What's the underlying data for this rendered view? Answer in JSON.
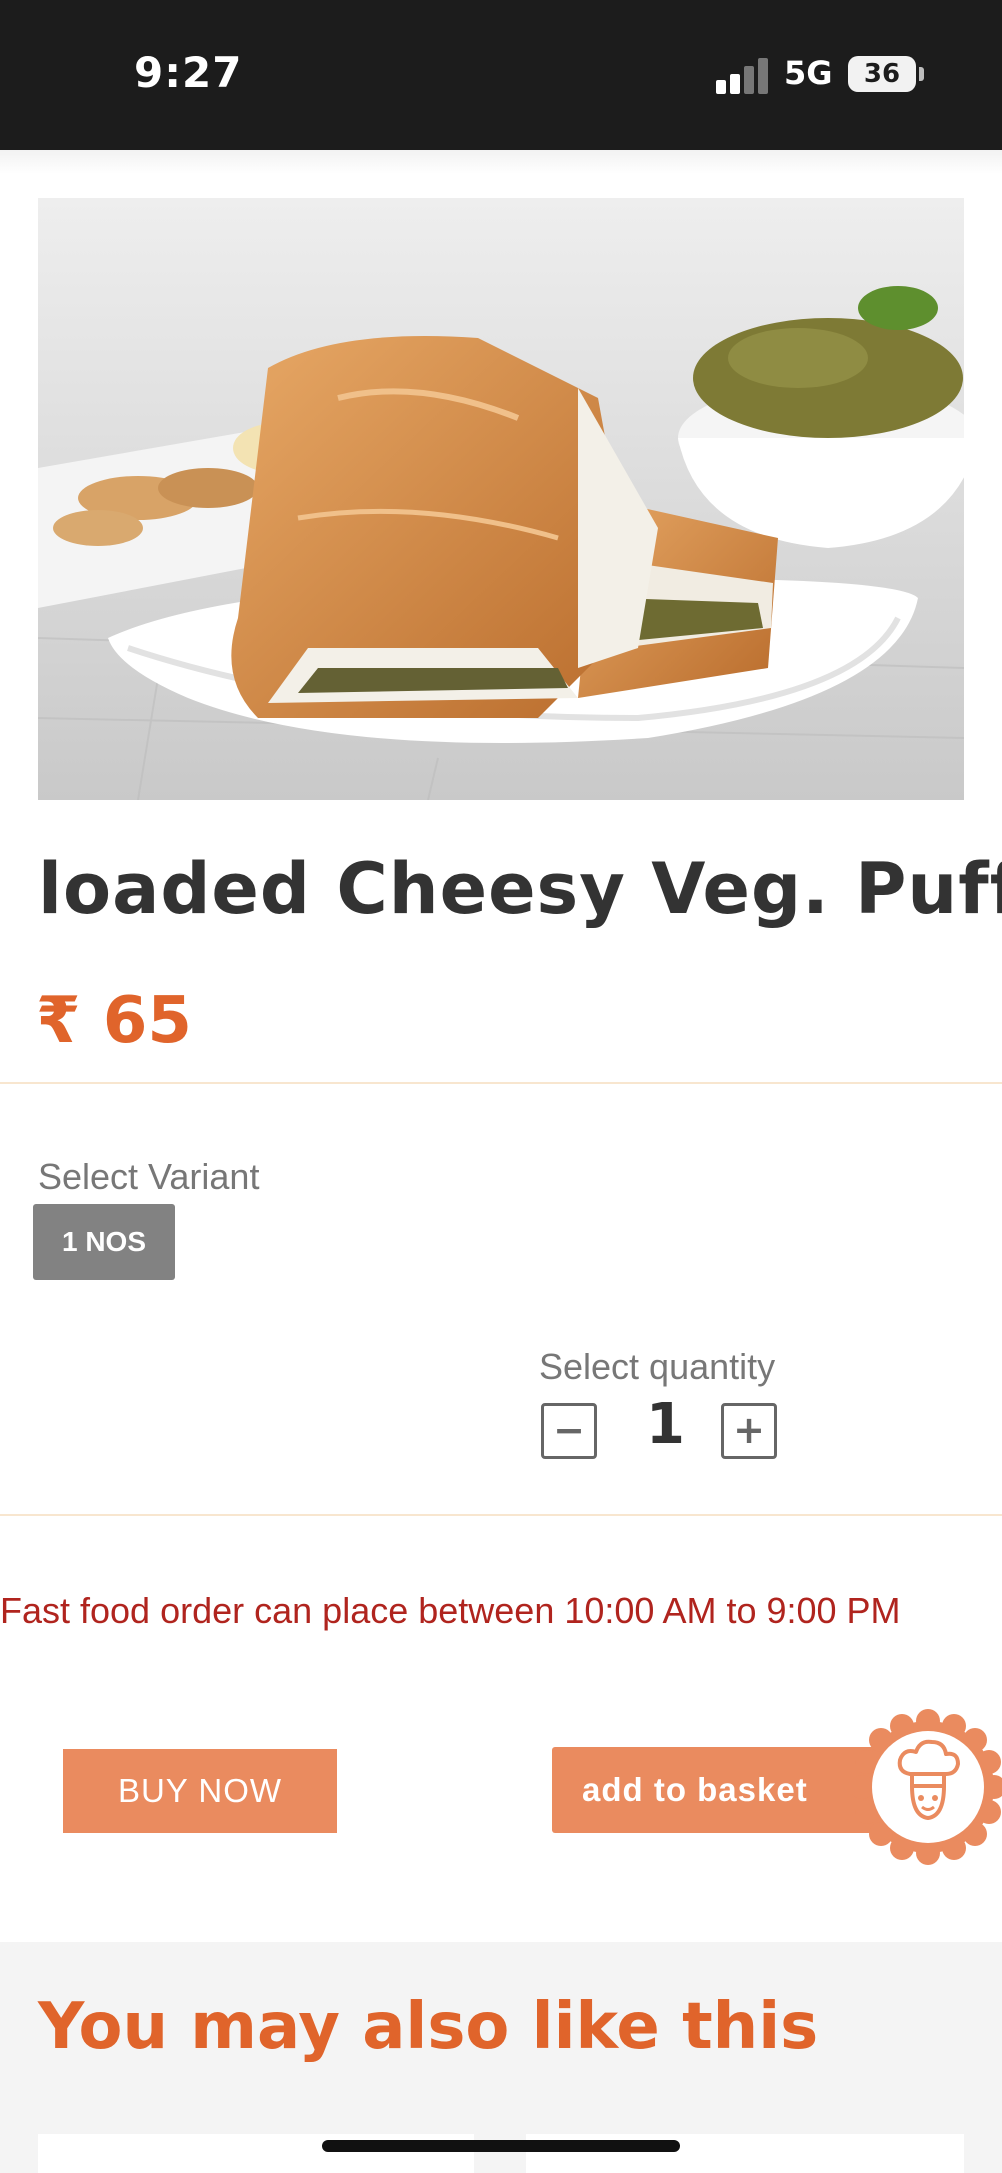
{
  "status_bar": {
    "time": "9:27",
    "network": "5G",
    "battery": "36"
  },
  "product": {
    "image_icon": "veg-puff-photo",
    "title": "loaded Cheesy Veg. Puff",
    "price": "₹ 65"
  },
  "variant": {
    "label": "Select Variant",
    "selected": "1 NOS"
  },
  "quantity": {
    "label": "Select quantity",
    "decrement": "−",
    "value": "1",
    "increment": "+"
  },
  "notice": "Fast food order can place between 10:00 AM to 9:00 PM",
  "actions": {
    "buy_now": "BUY NOW",
    "add_to_basket": "add to basket",
    "chef_icon": "chef-icon"
  },
  "recommendations": {
    "title": "You may also like this"
  },
  "colors": {
    "accent": "#e0642b",
    "button": "#ea8b5f",
    "notice": "#b0241e",
    "chip": "#828282"
  }
}
